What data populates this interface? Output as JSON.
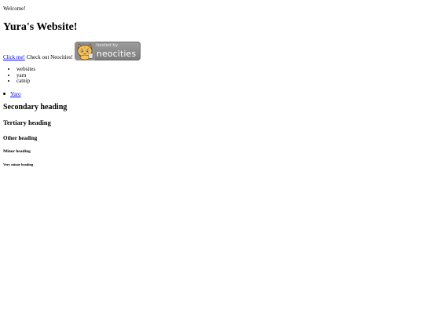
{
  "page": {
    "welcome": "Welcome!",
    "title": "Yura's Website!"
  },
  "promo": {
    "link_text": "Click me!",
    "tail_text": "Check out Neocities!",
    "badge": {
      "hosted_text": "hosted by",
      "brand_text": "neocities",
      "icon": "neocities-cat-icon"
    }
  },
  "interests": [
    "websites",
    "yarn",
    "catnip"
  ],
  "links": [
    "Yuro"
  ],
  "headings": {
    "secondary": "Secondary heading",
    "tertiary": "Tertiary heading",
    "other": "Other heading",
    "minor": "Minor heading",
    "very_minor": "Very minor heading"
  },
  "colors": {
    "link": "#0000ee",
    "text": "#000000",
    "background": "#ffffff",
    "badge": "#8a8a8a"
  }
}
